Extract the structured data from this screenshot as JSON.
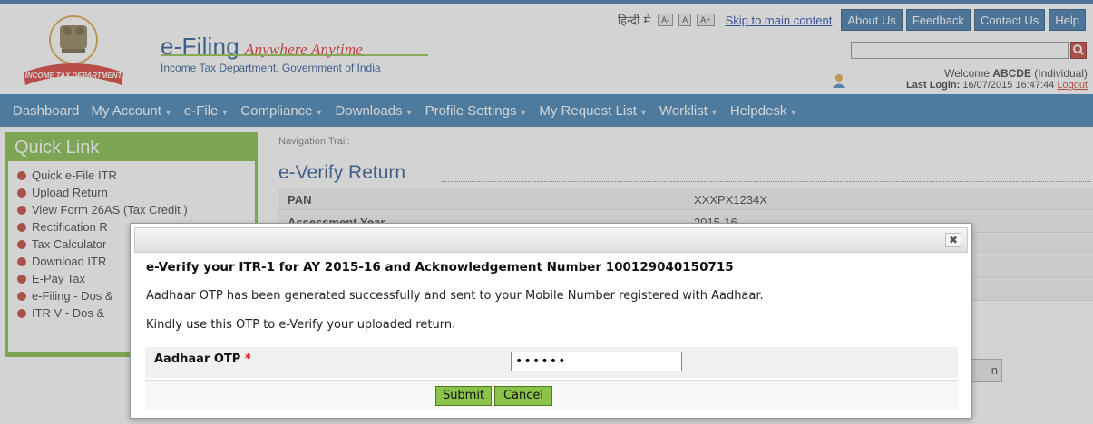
{
  "header": {
    "brand_title": "e-Filing",
    "brand_tagline": "Anywhere Anytime",
    "brand_subtitle": "Income Tax Department, Government of India",
    "emblem_ribbon": "INCOME TAX DEPARTMENT",
    "hindi_link": "हिन्दी मे",
    "font_small": "A-",
    "font_normal": "A",
    "font_large": "A+",
    "skip_link": "Skip to main content",
    "top_nav": [
      "About Us",
      "Feedback",
      "Contact Us",
      "Help"
    ],
    "search_placeholder": "",
    "welcome_prefix": "Welcome ",
    "welcome_user": "ABCDE",
    "welcome_suffix": " (Individual)",
    "last_login_label": "Last Login:",
    "last_login_value": " 16/07/2015 16:47:44 ",
    "logout": "Logout"
  },
  "main_nav": [
    "Dashboard",
    "My Account",
    "e-File",
    "Compliance",
    "Downloads",
    "Profile Settings",
    "My Request List",
    "Worklist",
    "Helpdesk"
  ],
  "quick_link": {
    "title": "Quick Link",
    "items": [
      "Quick e-File ITR",
      "Upload Return",
      "View Form 26AS (Tax Credit )",
      "Rectification R",
      "Tax Calculator",
      "Download ITR",
      "E-Pay Tax",
      "e-Filing - Dos &",
      "ITR V - Dos &"
    ]
  },
  "content": {
    "nav_trail": "Navigation Trail:",
    "page_title": "e-Verify Return",
    "rows": [
      {
        "label": "PAN",
        "value": "XXXPX1234X"
      },
      {
        "label": "Assessment Year",
        "value": "2015-16"
      }
    ],
    "bg_button": "n"
  },
  "dialog": {
    "close_glyph": "✖",
    "heading": "e-Verify your ITR-1 for AY 2015-16 and Acknowledgement Number 100129040150715",
    "message1": "Aadhaar OTP has been generated successfully and sent to your Mobile Number registered with Aadhaar.",
    "message2": "Kindly use this OTP to e-Verify your uploaded return.",
    "otp_label": "Aadhaar OTP",
    "required_marker": " *",
    "otp_value": "123456",
    "submit": "Submit",
    "cancel": "Cancel"
  },
  "colors": {
    "nav_blue": "#3478ad",
    "quick_green": "#7db93c",
    "button_green": "#8bc34a",
    "accent_red": "#c0392b"
  }
}
